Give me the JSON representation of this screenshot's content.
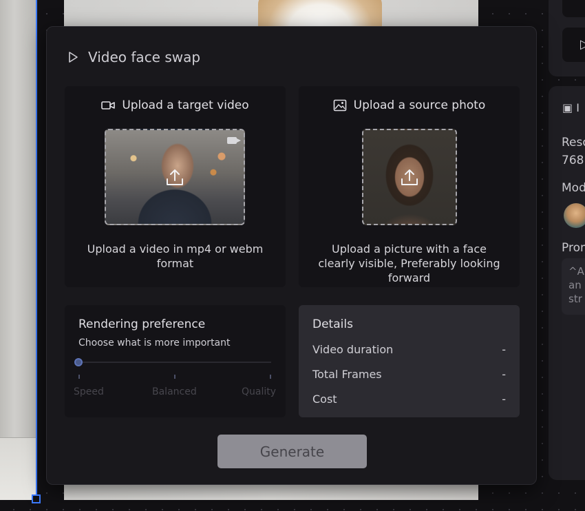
{
  "modal": {
    "title": "Video face swap",
    "target": {
      "heading": "Upload a target video",
      "description": "Upload a video in mp4 or webm format"
    },
    "source": {
      "heading": "Upload a source photo",
      "description": "Upload a picture with a face clearly visible, Preferably looking forward"
    },
    "preference": {
      "title": "Rendering preference",
      "subtitle": "Choose what is more important",
      "options": [
        "Speed",
        "Balanced",
        "Quality"
      ],
      "selected": "Speed"
    },
    "details": {
      "title": "Details",
      "rows": [
        {
          "label": "Video duration",
          "value": "-"
        },
        {
          "label": "Total Frames",
          "value": "-"
        },
        {
          "label": "Cost",
          "value": "-"
        }
      ]
    },
    "generate_label": "Generate"
  },
  "right_panel": {
    "header_label": "I",
    "lines": [
      "Reso",
      "768",
      "Mod",
      "Prom"
    ],
    "prompt_lines": [
      "^Al",
      "an",
      "str"
    ]
  },
  "icons": {
    "title_icon": "play-icon",
    "target_icon": "video-camera-icon",
    "source_icon": "image-icon",
    "upload_icon": "upload-icon"
  },
  "colors": {
    "modal_bg": "#19181c",
    "card_bg": "#141317",
    "details_bg": "#2c2b31",
    "selection_blue": "#3d7bff",
    "button_bg": "#8e8d94"
  }
}
